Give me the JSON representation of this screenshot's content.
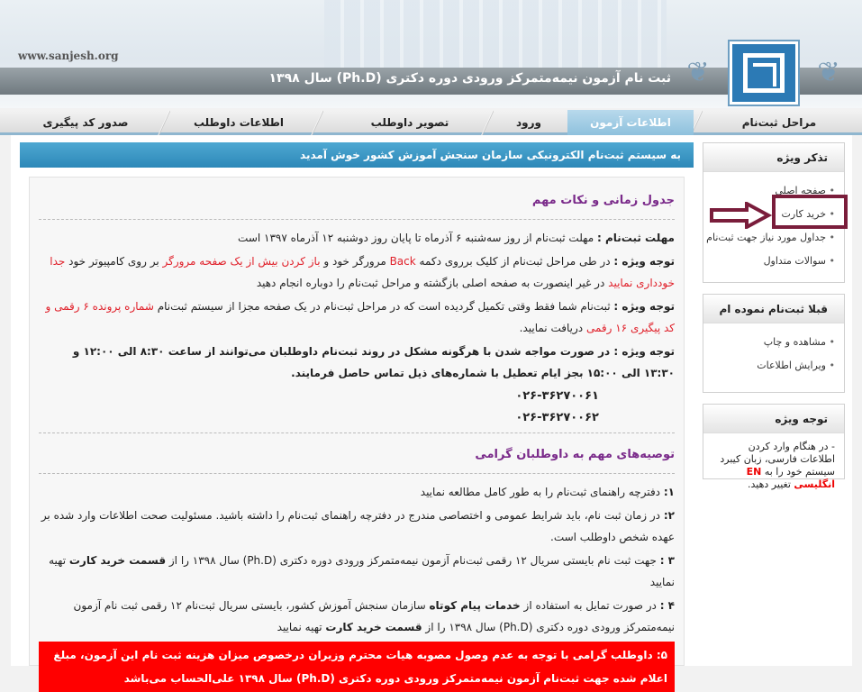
{
  "header": {
    "site_url": "www.sanjesh.org",
    "title": "ثبت نام آزمون نیمه‌متمرکز ورودی دوره دکتری (Ph.D) سال ۱۳۹۸"
  },
  "nav": {
    "tabs": [
      {
        "label": "مراحل ثبت‌نام",
        "active": false
      },
      {
        "label": "اطلاعات آزمون",
        "active": true
      },
      {
        "label": "ورود",
        "active": false
      },
      {
        "label": "تصویر داوطلب",
        "active": false
      },
      {
        "label": "اطلاعات داوطلب",
        "active": false
      },
      {
        "label": "صدور کد پیگیری",
        "active": false
      }
    ]
  },
  "welcome": "به سیستم ثبت‌نام الکترونیکی سازمان سنجش آموزش کشور خوش آمدید",
  "sidebar": {
    "box1": {
      "title": "تذکر ویژه",
      "items": [
        "صفحه اصلی",
        "خرید کارت",
        "جداول مورد نیاز جهت ثبت‌نام",
        "سوالات متداول"
      ]
    },
    "box2": {
      "title": "قبلا ثبت‌نام نموده ام",
      "items": [
        "مشاهده و چاپ",
        "ویرایش اطلاعات"
      ]
    },
    "box3": {
      "title": "توجه ویژه",
      "note_before": "- در هنگام وارد کردن اطلاعات فارسی، زبان کیبرد سیستم خود را به",
      "note_en": "EN انگلیسی",
      "note_after": "تغییر دهید."
    }
  },
  "content": {
    "section1_title": "جدول زمانی و نکات مهم",
    "deadline_label": "مهلت ثبت‌نام :",
    "deadline_text": "مهلت ثبت‌نام از روز سه‌شنبه ۶ آذرماه تا پایان روز دوشنبه ۱۲ آذرماه ۱۳۹۷ است",
    "note_label": "توجه ویژه :",
    "note1_a": "در طی مراحل ثبت‌نام از کلیک برروی دکمه",
    "note1_back": "Back",
    "note1_b": "مرورگر خود و",
    "note1_red": "باز کردن بیش از یک صفحه مرورگر",
    "note1_c": "بر روی کامپیوتر خود",
    "note1_red2": "جدا خودداری نمایید",
    "note1_d": "در غیر اینصورت به صفحه اصلی بازگشته و مراحل ثبت‌نام را دوباره انجام دهید",
    "note2_a": "ثبت‌نام شما فقط وقتی تکمیل گردیده است که در مراحل ثبت‌نام در یک صفحه مجزا از سیستم ثبت‌نام",
    "note2_red": "شماره پرونده ۶ رقمی و کد پیگیری ۱۶ رقمی",
    "note2_b": "دریافت نمایید.",
    "note3": "در صورت مواجه شدن با هرگونه مشکل در روند ثبت‌نام داوطلبان می‌توانند از ساعت ۸:۳۰ الی ۱۲:۰۰ و ۱۳:۳۰ الی ۱۵:۰۰ بجز ایام تعطیل با شماره‌های ذیل تماس حاصل فرمایند.",
    "phones": [
      "۰۲۶-۳۶۲۷۰۰۶۱",
      "۰۲۶-۳۶۲۷۰۰۶۲"
    ],
    "section2_title": "توصیه‌های مهم به داوطلبان گرامی",
    "r1_num": "۱:",
    "r1": "دفترچه راهنمای ثبت‌نام را به طور کامل مطالعه نمایید",
    "r2_num": "۲:",
    "r2": "در زمان ثبت نام، باید شرایط عمومی و اختصاصی مندرج در دفترچه راهنمای ثبت‌نام را داشته باشید. مسئولیت صحت اطلاعات وارد شده بر عهده شخص داوطلب است.",
    "r3_num": "۳ :",
    "r3_a": "جهت ثبت نام بایستی سریال ۱۲ رقمی ثبت‌نام آزمون نیمه‌متمرکز ورودی دوره دکتری (Ph.D) سال ۱۳۹۸ را از",
    "r3_bold": "قسمت خرید کارت",
    "r3_b": "تهیه نمایید",
    "r4_num": "۴ :",
    "r4_a": "در صورت تمایل به استفاده از",
    "r4_bold": "خدمات پیام کوتاه",
    "r4_b": "سازمان سنجش آموزش کشور، بایستی سریال ثبت‌نام ۱۲ رقمی ثبت نام آزمون نیمه‌متمرکز ورودی دوره دکتری (Ph.D) سال ۱۳۹۸ را از",
    "r4_bold2": "قسمت خرید کارت",
    "r4_c": "تهیه نمایید",
    "r5_num": "۵:",
    "r5": "داوطلب گرامی با توجه به عدم وصول مصوبه هیات محترم وزیران درخصوص میزان هزینه ثبت نام این آزمون، مبلغ اعلام شده جهت ثبت‌نام آزمون نیمه‌متمرکز ورودی دوره دکتری (Ph.D) سال ۱۳۹۸ علی‌الحساب می‌باشد"
  }
}
